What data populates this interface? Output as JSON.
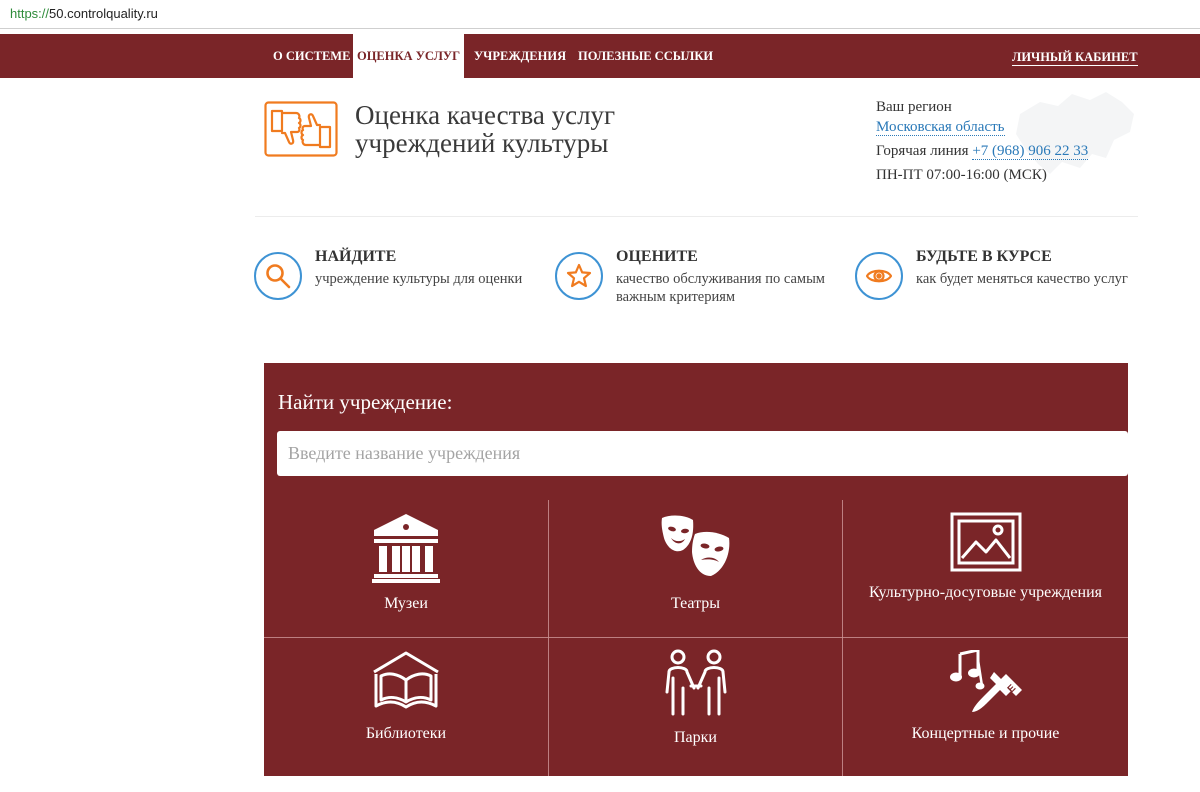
{
  "browser": {
    "url_protocol": "https://",
    "url_host": "50.controlquality.ru"
  },
  "nav": {
    "items": [
      {
        "label": "О СИСТЕМЕ"
      },
      {
        "label": "ОЦЕНКА УСЛУГ",
        "active": true
      },
      {
        "label": "УЧРЕЖДЕНИЯ"
      },
      {
        "label": "ПОЛЕЗНЫЕ ССЫЛКИ"
      }
    ],
    "account_label": "ЛИЧНЫЙ КАБИНЕТ"
  },
  "header": {
    "title_line1": "Оценка качества услуг",
    "title_line2": "учреждений культуры",
    "region_label": "Ваш регион",
    "region_value": "Московская область",
    "hotline_label": "Горячая линия",
    "hotline_phone": "+7 (968) 906 22 33",
    "hours": "ПН-ПТ 07:00-16:00 (МСК)"
  },
  "features": [
    {
      "icon": "magnifier-icon",
      "title": "НАЙДИТЕ",
      "text": "учреждение культуры для оценки"
    },
    {
      "icon": "star-icon",
      "title": "ОЦЕНИТЕ",
      "text": "качество обслуживания по самым важным критериям"
    },
    {
      "icon": "eye-icon",
      "title": "БУДЬТЕ В КУРСЕ",
      "text": "как будет меняться качество услуг"
    }
  ],
  "search": {
    "label": "Найти учреждение:",
    "placeholder": "Введите название учреждения",
    "value": ""
  },
  "categories": [
    {
      "icon": "museum-icon",
      "label": "Музеи"
    },
    {
      "icon": "theatre-masks-icon",
      "label": "Театры"
    },
    {
      "icon": "picture-frame-icon",
      "label": "Культурно-досуговые учреждения"
    },
    {
      "icon": "open-book-icon",
      "label": "Библиотеки"
    },
    {
      "icon": "people-handshake-icon",
      "label": "Парки"
    },
    {
      "icon": "music-and-brush-icon",
      "label": "Концертные и прочие"
    }
  ],
  "colors": {
    "brand": "#7a2528",
    "link": "#2a79b8",
    "accent_orange": "#f07b1f",
    "icon_circle_blue": "#3e93d4"
  }
}
